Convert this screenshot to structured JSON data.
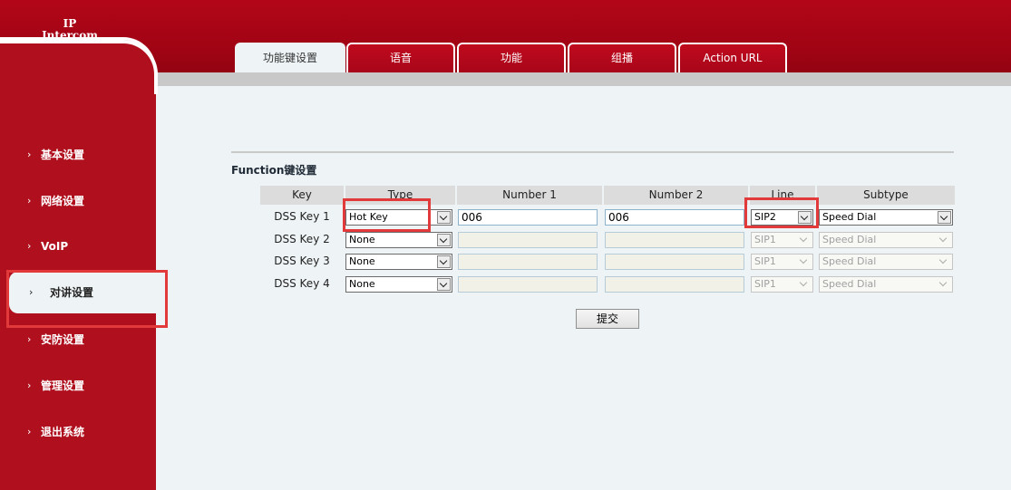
{
  "brand": "IP Intercom",
  "tabs": [
    "功能键设置",
    "语音",
    "功能",
    "组播",
    "Action URL"
  ],
  "active_tab": "功能键设置",
  "sidebar": {
    "items": [
      "基本设置",
      "网络设置",
      "VoIP",
      "对讲设置",
      "安防设置",
      "管理设置",
      "退出系统"
    ],
    "active": "对讲设置"
  },
  "section_title": "Function键设置",
  "table": {
    "headers": [
      "Key",
      "Type",
      "Number 1",
      "Number 2",
      "Line",
      "Subtype"
    ],
    "rows": [
      {
        "key": "DSS Key 1",
        "type": "Hot Key",
        "number1": "006",
        "number2": "006",
        "line": "SIP2",
        "subtype": "Speed Dial",
        "enabled": true
      },
      {
        "key": "DSS Key 2",
        "type": "None",
        "number1": "",
        "number2": "",
        "line": "SIP1",
        "subtype": "Speed Dial",
        "enabled": false
      },
      {
        "key": "DSS Key 3",
        "type": "None",
        "number1": "",
        "number2": "",
        "line": "SIP1",
        "subtype": "Speed Dial",
        "enabled": false
      },
      {
        "key": "DSS Key 4",
        "type": "None",
        "number1": "",
        "number2": "",
        "line": "SIP1",
        "subtype": "Speed Dial",
        "enabled": false
      }
    ]
  },
  "submit_label": "提交",
  "colors": {
    "header_red": "#a10414",
    "sidebar_red": "#b0101e",
    "highlight": "#e23a3a",
    "content_bg": "#eef3f5"
  }
}
